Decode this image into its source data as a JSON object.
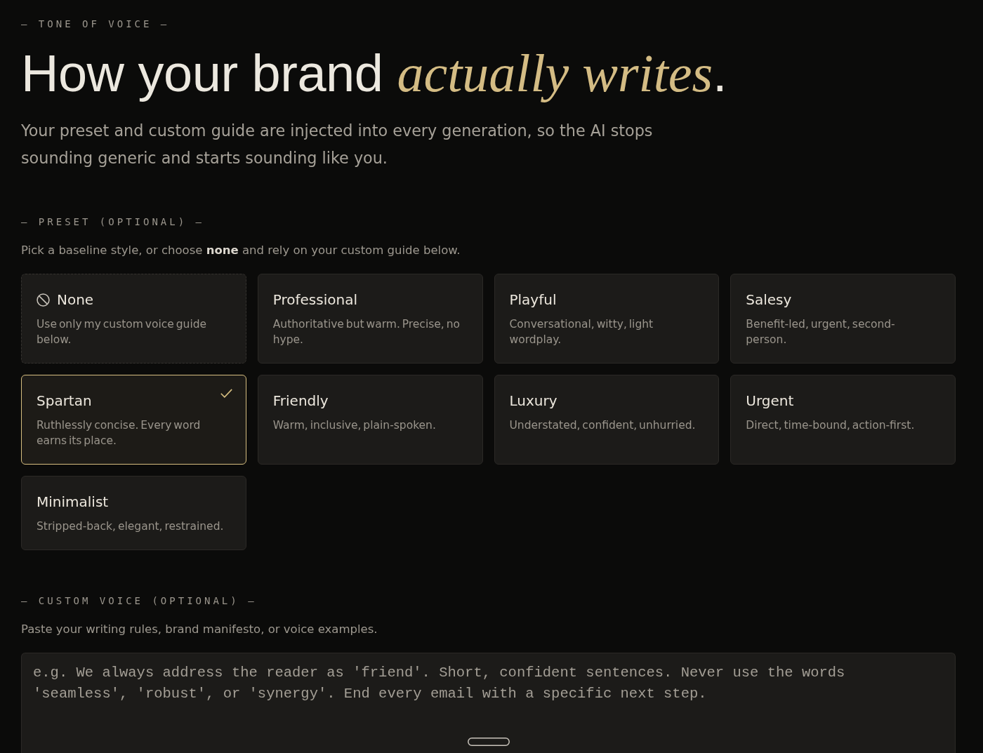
{
  "eyebrow": "— TONE OF VOICE —",
  "heading": "How your brand *actually writes*.",
  "intro": "Your preset and custom guide are injected into every generation, so the AI stops sounding generic and starts sounding like you.",
  "preset_section": {
    "label": "— PRESET (OPTIONAL) —",
    "hint": "Pick a baseline style, or choose **none** and rely on your custom guide below.",
    "options": [
      {
        "kind": "none",
        "title": "None",
        "description": "Use only my custom voice guide below.",
        "selected": false
      },
      {
        "kind": "preset",
        "title": "Professional",
        "description": "Authoritative but warm. Precise, no hype.",
        "selected": false
      },
      {
        "kind": "preset",
        "title": "Playful",
        "description": "Conversational, witty, light wordplay.",
        "selected": false
      },
      {
        "kind": "preset",
        "title": "Salesy",
        "description": "Benefit-led, urgent, second-person.",
        "selected": false
      },
      {
        "kind": "preset",
        "title": "Spartan",
        "description": "Ruthlessly concise. Every word earns its place.",
        "selected": true
      },
      {
        "kind": "preset",
        "title": "Friendly",
        "description": "Warm, inclusive, plain-spoken.",
        "selected": false
      },
      {
        "kind": "preset",
        "title": "Luxury",
        "description": "Understated, confident, unhurried.",
        "selected": false
      },
      {
        "kind": "preset",
        "title": "Urgent",
        "description": "Direct, time-bound, action-first.",
        "selected": false
      },
      {
        "kind": "preset",
        "title": "Minimalist",
        "description": "Stripped-back, elegant, restrained.",
        "selected": false
      }
    ]
  },
  "custom_section": {
    "label": "— CUSTOM VOICE (OPTIONAL) —",
    "hint": "Paste your writing rules, brand manifesto, or voice examples.",
    "guide_field": {
      "placeholder": "e.g. We always address the reader as 'friend'. Short, confident sentences. Never use the words 'seamless', 'robust', or 'synergy'. End every email with a specific next step."
    }
  }
}
